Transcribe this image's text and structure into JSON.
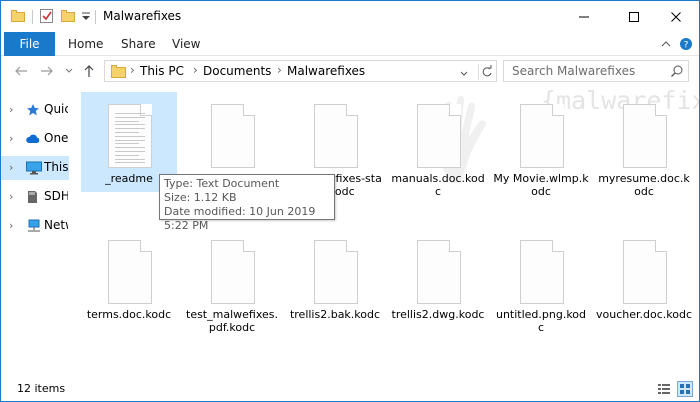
{
  "window": {
    "title": "Malwarefixes",
    "accent": "#1979ca"
  },
  "ribbon": {
    "file_label": "File",
    "tabs": [
      "Home",
      "Share",
      "View"
    ]
  },
  "address": {
    "breadcrumbs": [
      "This PC",
      "Documents",
      "Malwarefixes"
    ],
    "search_placeholder": "Search Malwarefixes"
  },
  "nav": {
    "items": [
      {
        "label": "Quick access",
        "icon": "star-icon"
      },
      {
        "label": "OneDrive",
        "icon": "cloud-icon"
      },
      {
        "label": "This PC",
        "icon": "monitor-icon"
      },
      {
        "label": "SDHC",
        "icon": "sd-card-icon"
      },
      {
        "label": "Network",
        "icon": "network-icon"
      }
    ]
  },
  "watermark": "{malwarefixes}",
  "files": [
    {
      "name": "_readme",
      "lined": true
    },
    {
      "name": "",
      "lined": false
    },
    {
      "name": "malwarefixes-stats.kodc",
      "lined": false
    },
    {
      "name": "manuals.doc.kodc",
      "lined": false
    },
    {
      "name": "My Movie.wlmp.kodc",
      "lined": false
    },
    {
      "name": "myresume.doc.kodc",
      "lined": false
    },
    {
      "name": "terms.doc.kodc",
      "lined": false
    },
    {
      "name": "test_malwefixes.pdf.kodc",
      "lined": false
    },
    {
      "name": "trellis2.bak.kodc",
      "lined": false
    },
    {
      "name": "trellis2.dwg.kodc",
      "lined": false
    },
    {
      "name": "untitled.png.kodc",
      "lined": false
    },
    {
      "name": "voucher.doc.kodc",
      "lined": false
    }
  ],
  "tooltip": {
    "type": "Type: Text Document",
    "size": "Size: 1.12 KB",
    "modified": "Date modified: 10 Jun 2019 5:22 PM"
  },
  "status": {
    "items_count": "12 items"
  }
}
